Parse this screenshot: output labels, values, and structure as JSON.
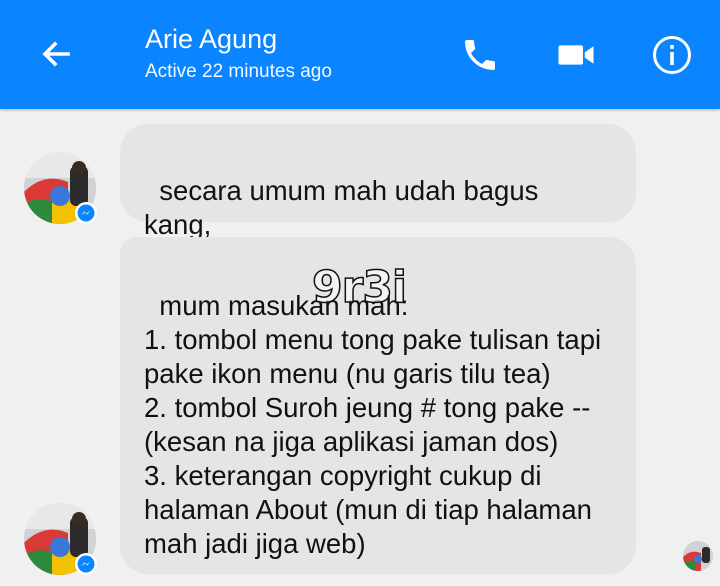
{
  "header": {
    "contact_name": "Arie Agung",
    "status": "Active 22 minutes ago",
    "icons": {
      "back": "arrow-left-icon",
      "call": "phone-icon",
      "video": "video-camera-icon",
      "info": "info-icon"
    },
    "background_color": "#0a84ff"
  },
  "messages": [
    {
      "sender": "Arie Agung",
      "text": "secara umum mah udah bagus kang,"
    },
    {
      "sender": "Arie Agung",
      "text": "mum masukan mah:\n1. tombol menu tong pake tulisan tapi pake ikon menu (nu garis tilu tea)\n2. tombol Suroh jeung # tong pake -- (kesan na jiga aplikasi jaman dos)\n3. keterangan copyright cukup di halaman About (mun di tiap halaman mah jadi jiga web)"
    }
  ],
  "watermark": "9r3i",
  "colors": {
    "bubble": "#e5e5e5",
    "background": "#f0f0f0",
    "messenger_badge": "#0a84ff"
  }
}
